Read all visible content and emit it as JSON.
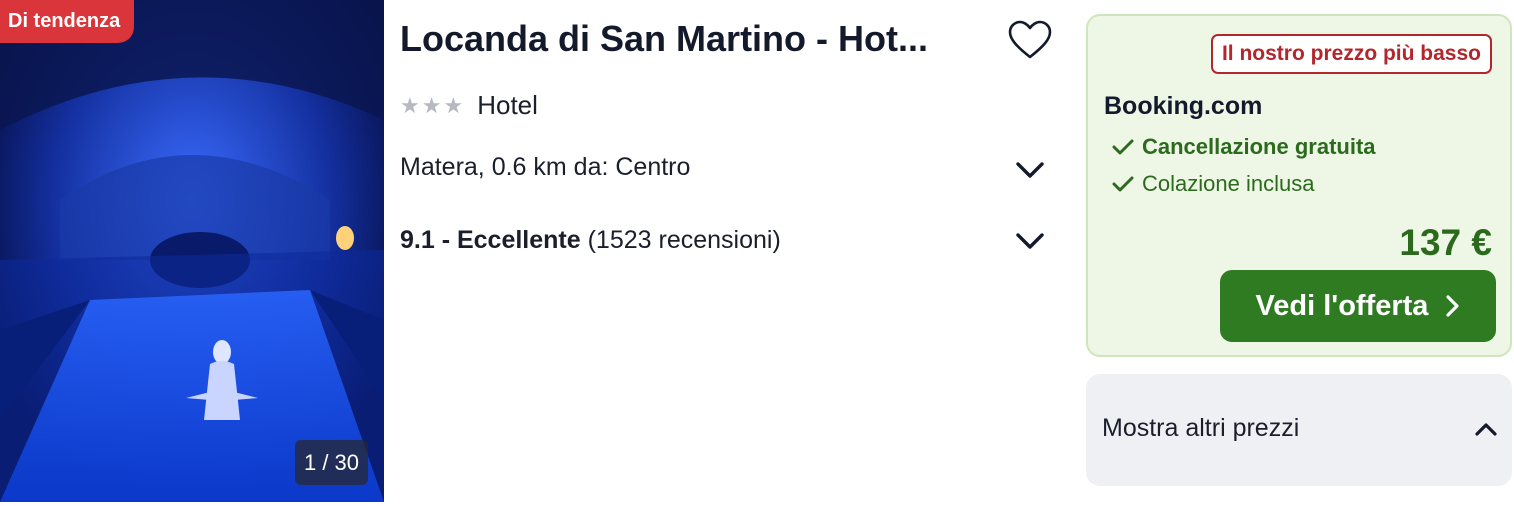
{
  "photo": {
    "badge": "Di tendenza",
    "counter": "1 / 30"
  },
  "hotel": {
    "title": "Locanda di San Martino - Hot...",
    "stars": 3,
    "type": "Hotel",
    "location": "Matera, 0.6 km da: Centro",
    "rating_score": "9.1 - Eccellente",
    "rating_reviews": "(1523 recensioni)"
  },
  "deal": {
    "tag": "Il nostro prezzo più basso",
    "provider": "Booking.com",
    "perks": [
      "Cancellazione gratuita",
      "Colazione inclusa"
    ],
    "price": "137 €",
    "cta_label": "Vedi l'offerta"
  },
  "more_prices": {
    "label": "Mostra altri prezzi"
  },
  "colors": {
    "badge_red": "#d9353a",
    "deal_green": "#2e7b22",
    "tag_red": "#b3262c",
    "deal_bg": "#eef7e6"
  },
  "icons": {
    "favorite": "heart-outline-icon",
    "expand": "chevron-down-icon",
    "collapse": "chevron-up-icon",
    "perk": "check-icon",
    "cta": "chevron-right-icon"
  }
}
